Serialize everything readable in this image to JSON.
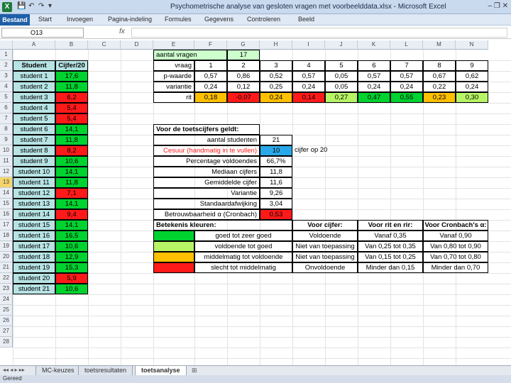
{
  "window": {
    "title": "Psychometrische analyse van gesloten vragen met voorbeelddata.xlsx - Microsoft Excel",
    "app_icon": "X",
    "controls": "–  ❐  ✕"
  },
  "ribbon": {
    "tabs": [
      "Bestand",
      "Start",
      "Invoegen",
      "Pagina-indeling",
      "Formules",
      "Gegevens",
      "Controleren",
      "Beeld"
    ]
  },
  "formula_bar": {
    "name_box": "O13",
    "fx": "fx",
    "value": ""
  },
  "columns": [
    "A",
    "B",
    "C",
    "D",
    "E",
    "F",
    "G",
    "H",
    "I",
    "J",
    "K",
    "L",
    "M",
    "N"
  ],
  "rows": [
    "1",
    "2",
    "3",
    "4",
    "5",
    "6",
    "7",
    "8",
    "9",
    "10",
    "11",
    "12",
    "13",
    "14",
    "15",
    "16",
    "17",
    "18",
    "19",
    "20",
    "21",
    "22",
    "23",
    "24",
    "25",
    "26",
    "27",
    "28"
  ],
  "selected_row": "13",
  "colors": {
    "green": "#00d230",
    "lightgreen": "#b8f566",
    "orange": "#ffc000",
    "red": "#ff1a1a",
    "blue": "#29a8e8",
    "teal": "#b7e3e4",
    "pale": "#ccffcc"
  },
  "students": {
    "header_student": "Student",
    "header_grade": "Cijfer/20",
    "list": [
      {
        "name": "student 1",
        "grade": "17,6",
        "color": "green"
      },
      {
        "name": "student 2",
        "grade": "11,8",
        "color": "green"
      },
      {
        "name": "student 3",
        "grade": "6,2",
        "color": "red"
      },
      {
        "name": "student 4",
        "grade": "5,4",
        "color": "red"
      },
      {
        "name": "student 5",
        "grade": "5,4",
        "color": "red"
      },
      {
        "name": "student 6",
        "grade": "14,1",
        "color": "green"
      },
      {
        "name": "student 7",
        "grade": "11,8",
        "color": "green"
      },
      {
        "name": "student 8",
        "grade": "8,2",
        "color": "red"
      },
      {
        "name": "student 9",
        "grade": "10,6",
        "color": "green"
      },
      {
        "name": "student 10",
        "grade": "14,1",
        "color": "green"
      },
      {
        "name": "student 11",
        "grade": "11,8",
        "color": "green"
      },
      {
        "name": "student 12",
        "grade": "7,1",
        "color": "red"
      },
      {
        "name": "student 13",
        "grade": "14,1",
        "color": "green"
      },
      {
        "name": "student 14",
        "grade": "9,4",
        "color": "red"
      },
      {
        "name": "student 15",
        "grade": "14,1",
        "color": "green"
      },
      {
        "name": "student 16",
        "grade": "16,5",
        "color": "green"
      },
      {
        "name": "student 17",
        "grade": "10,6",
        "color": "green"
      },
      {
        "name": "student 18",
        "grade": "12,9",
        "color": "green"
      },
      {
        "name": "student 19",
        "grade": "15,3",
        "color": "green"
      },
      {
        "name": "student 20",
        "grade": "5,9",
        "color": "red"
      },
      {
        "name": "student 21",
        "grade": "10,6",
        "color": "green"
      }
    ]
  },
  "items": {
    "count_label": "aantal vragen",
    "count_value": "17",
    "row_labels": [
      "vraag",
      "p-waarde",
      "variantie",
      "rit"
    ],
    "columns": [
      {
        "vraag": "1",
        "p": "0,57",
        "var": "0,24",
        "rit": "0,18",
        "color": "orange"
      },
      {
        "vraag": "2",
        "p": "0,86",
        "var": "0,12",
        "rit": "-0,07",
        "color": "red"
      },
      {
        "vraag": "3",
        "p": "0,52",
        "var": "0,25",
        "rit": "0,24",
        "color": "orange"
      },
      {
        "vraag": "4",
        "p": "0,57",
        "var": "0,24",
        "rit": "0,14",
        "color": "red"
      },
      {
        "vraag": "5",
        "p": "0,05",
        "var": "0,05",
        "rit": "0,27",
        "color": "lightgreen"
      },
      {
        "vraag": "6",
        "p": "0,57",
        "var": "0,24",
        "rit": "0,47",
        "color": "green"
      },
      {
        "vraag": "7",
        "p": "0,57",
        "var": "0,24",
        "rit": "0,55",
        "color": "green"
      },
      {
        "vraag": "8",
        "p": "0,67",
        "var": "0,22",
        "rit": "0,23",
        "color": "orange"
      },
      {
        "vraag": "9",
        "p": "0,62",
        "var": "0,24",
        "rit": "0,30",
        "color": "lightgreen"
      }
    ]
  },
  "stats": {
    "header": "Voor de toetscijfers geldt:",
    "rows": [
      {
        "label": "aantal studenten",
        "value": "21",
        "label_color": "",
        "value_color": ""
      },
      {
        "label": "Cesuur (handmatig in te vullen)",
        "value": "10",
        "label_color": "red",
        "value_color": "blue",
        "note": "cijfer op 20"
      },
      {
        "label": "Percentage voldoendes",
        "value": "66,7%",
        "label_color": "",
        "value_color": ""
      },
      {
        "label": "Mediaan cijfers",
        "value": "11,8",
        "label_color": "",
        "value_color": ""
      },
      {
        "label": "Gemiddelde cijfer",
        "value": "11,6",
        "label_color": "",
        "value_color": ""
      },
      {
        "label": "Variantie",
        "value": "9,26",
        "label_color": "",
        "value_color": ""
      },
      {
        "label": "Standaardafwijking",
        "value": "3,04",
        "label_color": "",
        "value_color": ""
      },
      {
        "label": "Betrouwbaarheid α (Cronbach)",
        "value": "0,53",
        "label_color": "",
        "value_color": "red"
      }
    ]
  },
  "legend": {
    "header": "Betekenis kleuren:",
    "col_cijfer": "Voor cijfer:",
    "col_rit": "Voor rit en rir:",
    "col_cronbach": "Voor Cronbach's α:",
    "rows": [
      {
        "color": "green",
        "meaning": "goed tot zeer goed",
        "cijfer": "Voldoende",
        "rit": "Vanaf 0,35",
        "cronbach": "Vanaf 0,90"
      },
      {
        "color": "lightgreen",
        "meaning": "voldoende tot goed",
        "cijfer": "Niet van toepassing",
        "rit": "Van 0,25 tot 0,35",
        "cronbach": "Van 0,80 tot 0,90"
      },
      {
        "color": "orange",
        "meaning": "middelmatig tot voldoende",
        "cijfer": "Niet van toepassing",
        "rit": "Van 0,15 tot 0,25",
        "cronbach": "Van 0,70 tot 0,80"
      },
      {
        "color": "red",
        "meaning": "slecht tot middelmatig",
        "cijfer": "Onvoldoende",
        "rit": "Minder dan 0,15",
        "cronbach": "Minder dan 0,70"
      }
    ]
  },
  "sheet_tabs": [
    "MC-keuzes",
    "toetsresultaten",
    "toetsanalyse"
  ],
  "active_sheet": "toetsanalyse",
  "status": "Gereed"
}
